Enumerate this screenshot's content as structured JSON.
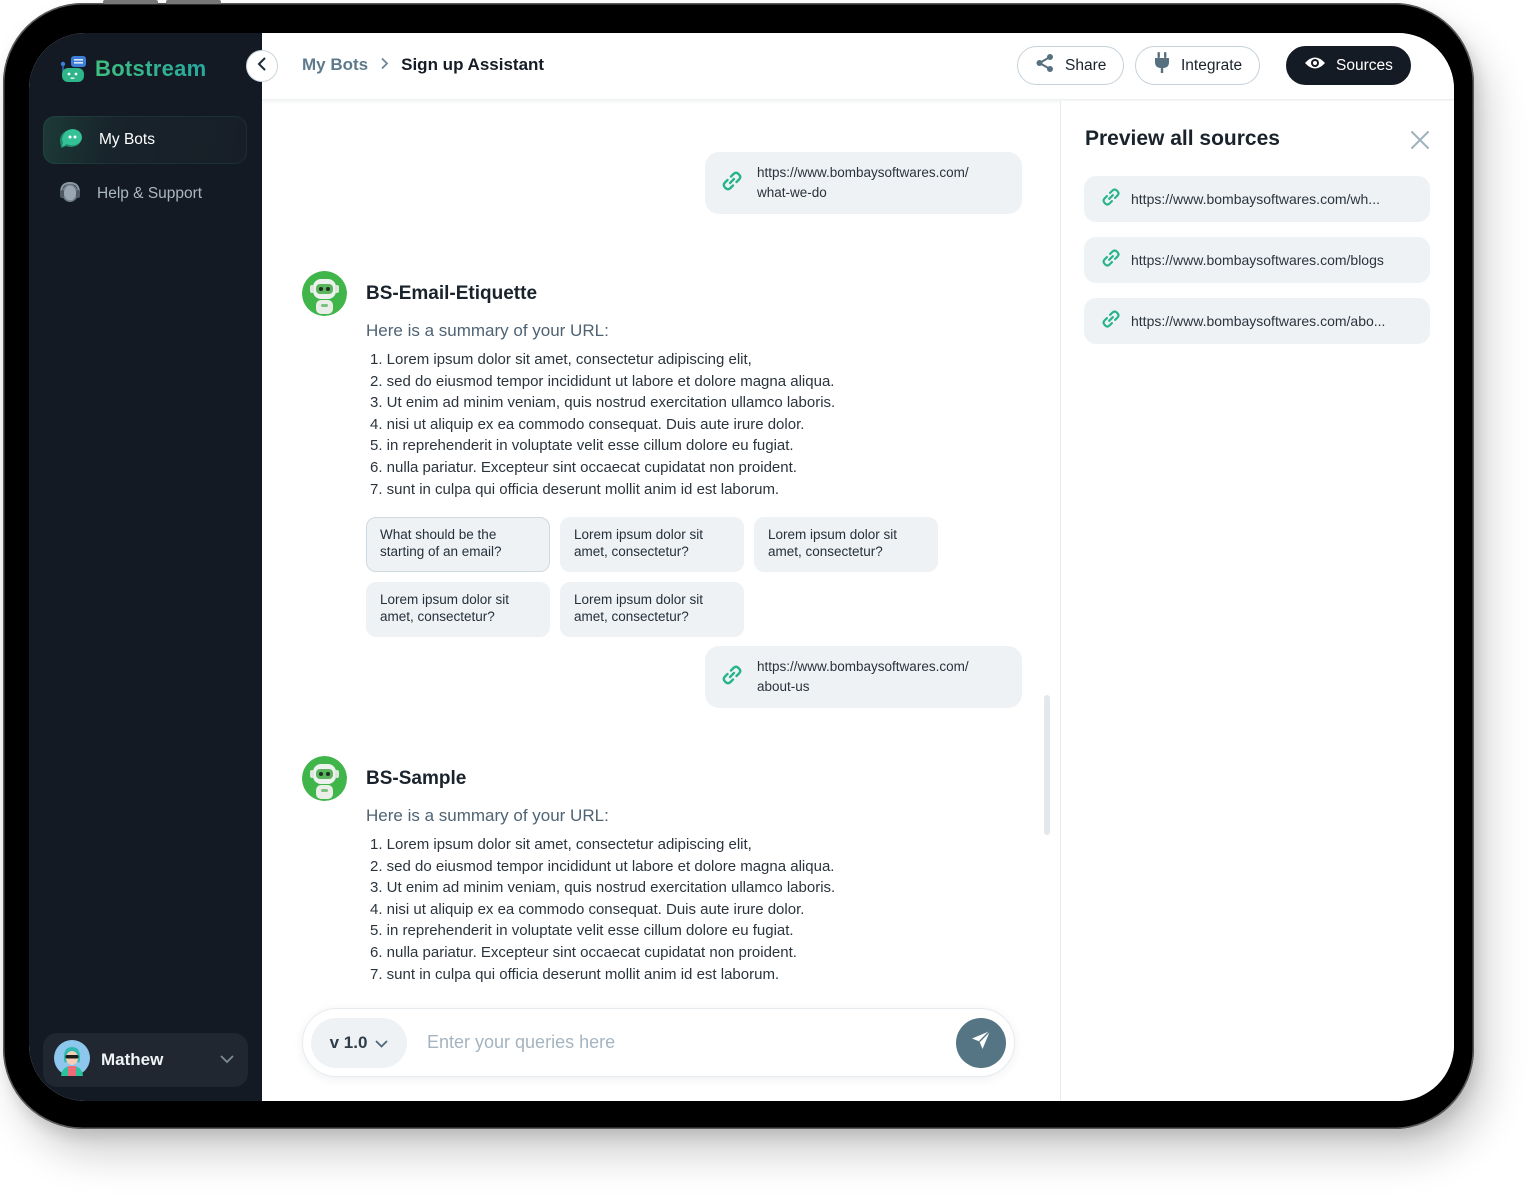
{
  "app": {
    "brand_name": "Botstream",
    "accent_color": "#2fb58a",
    "dark_color": "#141a23"
  },
  "sidebar": {
    "items": [
      {
        "label": "My Bots",
        "icon": "chat-bubbles-icon",
        "active": true
      },
      {
        "label": "Help & Support",
        "icon": "headset-icon",
        "active": false
      }
    ],
    "user": {
      "name": "Mathew",
      "icon": "chevron-down-icon"
    }
  },
  "header": {
    "breadcrumb": [
      {
        "label": "My Bots"
      },
      {
        "label": "Sign up Assistant"
      }
    ],
    "buttons": {
      "share": "Share",
      "integrate": "Integrate",
      "sources": "Sources"
    }
  },
  "chat": {
    "messages": [
      {
        "type": "url",
        "url_line1": "https://www.bombaysoftwares.com/",
        "url_line2": "what-we-do"
      },
      {
        "type": "bot",
        "name": "BS-Email-Etiquette",
        "intro": "Here is a summary of your URL:",
        "items": [
          "1. Lorem ipsum dolor sit amet, consectetur adipiscing elit,",
          "2. sed do eiusmod tempor incididunt ut labore et dolore magna aliqua.",
          "3. Ut enim ad minim veniam, quis nostrud exercitation ullamco laboris.",
          "4. nisi ut aliquip ex ea commodo consequat. Duis aute irure dolor.",
          "5. in reprehenderit in voluptate velit esse cillum dolore eu fugiat.",
          "6. nulla pariatur. Excepteur sint occaecat cupidatat non proident.",
          "7. sunt in culpa qui officia deserunt mollit anim id est laborum."
        ],
        "suggestions": [
          "What should be the starting of an email?",
          "Lorem ipsum dolor sit amet, consectetur?",
          "Lorem ipsum dolor sit amet, consectetur?",
          "Lorem ipsum dolor sit amet, consectetur?",
          "Lorem ipsum dolor sit amet, consectetur?"
        ]
      },
      {
        "type": "url",
        "url_line1": "https://www.bombaysoftwares.com/",
        "url_line2": "about-us"
      },
      {
        "type": "bot",
        "name": "BS-Sample",
        "intro": "Here is a summary of your URL:",
        "items": [
          "1. Lorem ipsum dolor sit amet, consectetur adipiscing elit,",
          "2. sed do eiusmod tempor incididunt ut labore et dolore magna aliqua.",
          "3. Ut enim ad minim veniam, quis nostrud exercitation ullamco laboris.",
          "4. nisi ut aliquip ex ea commodo consequat. Duis aute irure dolor.",
          "5. in reprehenderit in voluptate velit esse cillum dolore eu fugiat.",
          "6. nulla pariatur. Excepteur sint occaecat cupidatat non proident.",
          "7. sunt in culpa qui officia deserunt mollit anim id est laborum."
        ]
      }
    ],
    "composer": {
      "version": "v 1.0",
      "placeholder": "Enter your queries here"
    }
  },
  "sources_panel": {
    "title": "Preview all sources",
    "items": [
      "https://www.bombaysoftwares.com/wh...",
      "https://www.bombaysoftwares.com/blogs",
      "https://www.bombaysoftwares.com/abo..."
    ]
  }
}
